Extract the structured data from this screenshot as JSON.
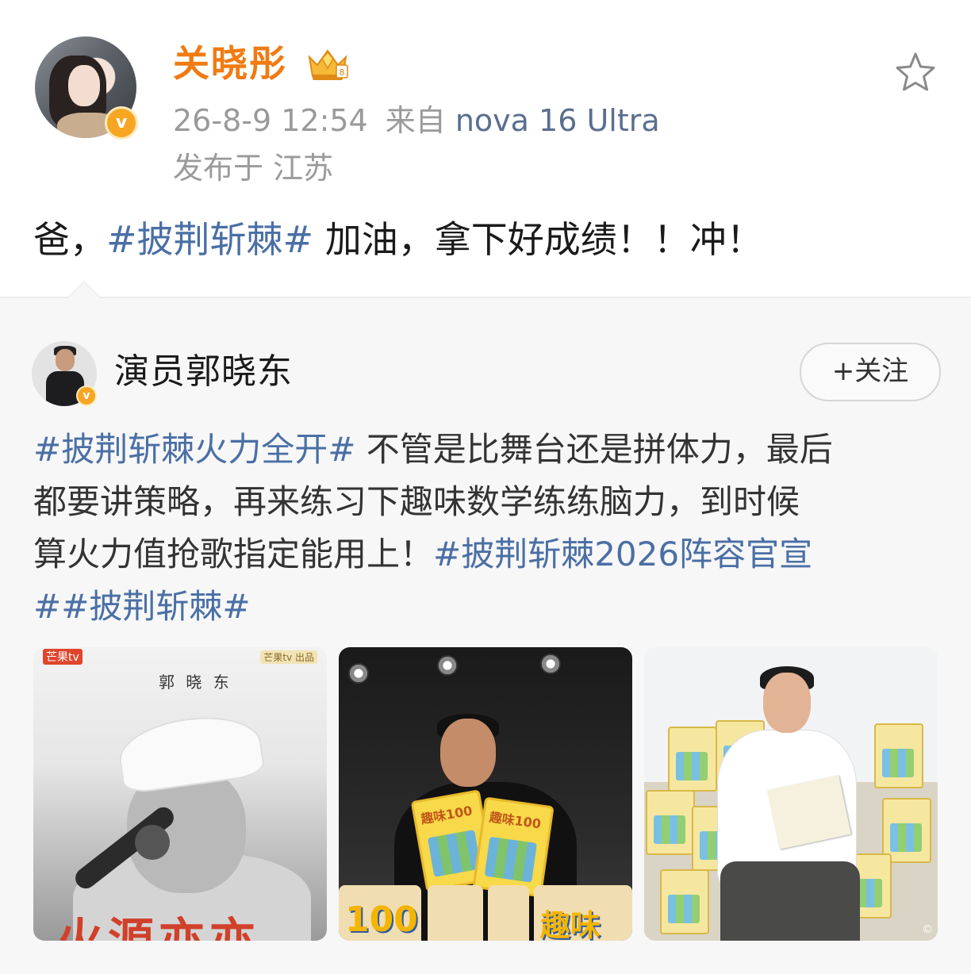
{
  "post": {
    "username": "关晓彤",
    "timestamp": "26-8-9 12:54",
    "source_prefix": "来自",
    "device": "nova 16 Ultra",
    "location": "发布于 江苏",
    "text_before": "爸，",
    "hashtag": "#披荆斩棘#",
    "text_after": " 加油，拿下好成绩！！冲！",
    "verified_badge": "v",
    "icons": {
      "favorite": "star-icon",
      "member": "crown-icon"
    }
  },
  "repost": {
    "author": "演员郭晓东",
    "verified_badge": "v",
    "follow_label": "+关注",
    "lines": [
      {
        "tag": "#披荆斩棘火力全开#",
        "text": " 不管是比舞台还是拼体力，最后"
      },
      {
        "tag": "",
        "text": "都要讲策略，再来练习下趣味数学练练脑力，到时候"
      },
      {
        "tag_after": "#披荆斩棘2026阵容官宣",
        "text": "算火力值抢歌指定能用上！"
      },
      {
        "tag": "##披荆斩棘#",
        "text": ""
      }
    ],
    "images": [
      {
        "label": "photo-1",
        "logo": "芒果tv",
        "logo2": "芒果tv 出品",
        "name_overlay": "郭 晓 东",
        "red_text": "火源亦亦"
      },
      {
        "label": "photo-2",
        "book_title": "趣味100",
        "box_text_1": "100",
        "box_text_2": "趣味"
      },
      {
        "label": "photo-3",
        "watermark": "©"
      }
    ]
  },
  "colors": {
    "username": "#f07b12",
    "hashtag": "#4a6fa5",
    "meta": "#9a9a9a",
    "device": "#5a6f8e",
    "badge": "#f6a623"
  }
}
